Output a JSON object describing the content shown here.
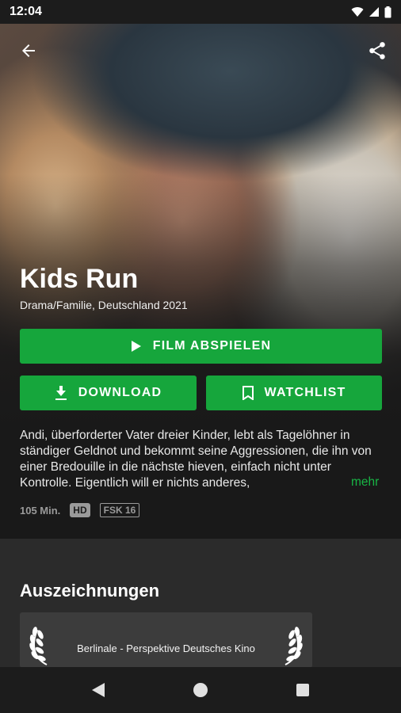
{
  "status": {
    "time": "12:04"
  },
  "movie": {
    "title": "Kids Run",
    "subtitle": "Drama/Familie, Deutschland 2021",
    "description": "Andi, überforderter Vater dreier Kinder, lebt als Tagelöhner in ständiger Geldnot und bekommt seine Aggressionen, die ihn von einer Bredouille in die nächste hieven, einfach nicht unter Kontrolle. Eigentlich will er nichts anderes,",
    "more_label": "mehr",
    "duration": "105 Min.",
    "quality": "HD",
    "rating": "FSK 16"
  },
  "buttons": {
    "play_label": "FILM ABSPIELEN",
    "download_label": "DOWNLOAD",
    "watchlist_label": "WATCHLIST"
  },
  "awards": {
    "heading": "Auszeichnungen",
    "items": [
      {
        "label": "Berlinale - Perspektive Deutsches Kino"
      }
    ]
  },
  "icons": {
    "back": "arrow-back-icon",
    "share": "share-icon",
    "play": "play-icon",
    "download": "download-icon",
    "bookmark": "bookmark-icon",
    "laurel": "laurel-icon"
  },
  "colors": {
    "accent": "#16a63c",
    "link": "#18b545",
    "background": "#191919"
  }
}
